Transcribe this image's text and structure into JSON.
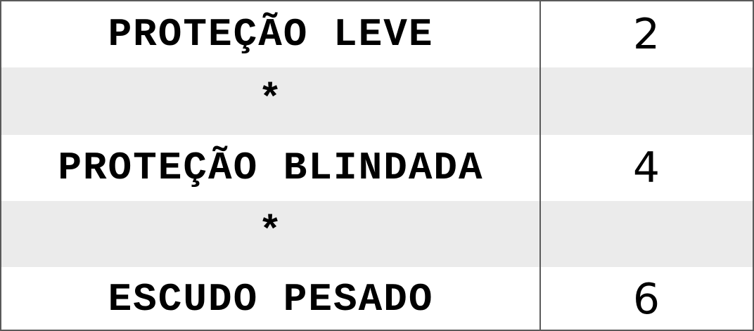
{
  "table": {
    "rows": [
      {
        "name": "PROTEÇÃO LEVE",
        "value": "2"
      },
      {
        "name": "*",
        "value": ""
      },
      {
        "name": "PROTEÇÃO BLINDADA",
        "value": "4"
      },
      {
        "name": "*",
        "value": ""
      },
      {
        "name": "ESCUDO PESADO",
        "value": "6"
      }
    ]
  },
  "colors": {
    "border": "#5a5a5a",
    "shaded_row": "#ebebeb",
    "text": "#000000"
  }
}
